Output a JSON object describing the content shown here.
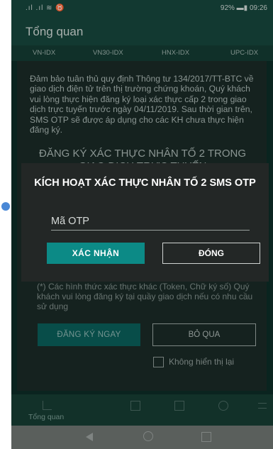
{
  "status_bar": {
    "signal": ".ıl .ıl ≋ ♉",
    "battery": "92% ▬▮ 09:26"
  },
  "header": {
    "title": "Tổng quan"
  },
  "market_tabs": [
    "VN-IDX",
    "VN30-IDX",
    "HNX-IDX",
    "UPC-IDX"
  ],
  "notice": {
    "text": "Đảm bảo tuân thủ quy định Thông tư 134/2017/TT-BTC về giao dịch điện tử trên thị trường chứng khoán, Quý khách vui lòng thực hiện đăng ký loại xác thực cấp 2 trong giao dịch trực tuyến trước ngày 04/11/2019. Sau thời gian trên, SMS OTP sẽ được áp dụng cho các KH chưa thực hiện đăng ký.",
    "register_title": "ĐĂNG KÝ XÁC THỰC NHÂN TỐ 2 TRONG GIAO DỊCH TRỰC TUYẾN",
    "other_methods": "(*) Các hình thức xác thực khác (Token, Chữ ký số) Quý khách vui lòng đăng ký tại quầy giao dịch nếu có nhu cầu sử dụng",
    "register_now": "ĐĂNG KÝ NGAY",
    "skip": "BỎ QUA",
    "dont_show": "Không hiển thị lại"
  },
  "dialog": {
    "title": "KÍCH HOẠT XÁC THỰC NHÂN TỐ 2 SMS OTP",
    "otp_placeholder": "Mã OTP",
    "confirm": "XÁC NHẬN",
    "close": "ĐÓNG"
  },
  "bottom_nav": {
    "overview": "Tổng quan"
  },
  "colors": {
    "dialog_confirm": "#0c8a86",
    "app_header": "#16463c",
    "side_dot": "#4a88d6"
  }
}
